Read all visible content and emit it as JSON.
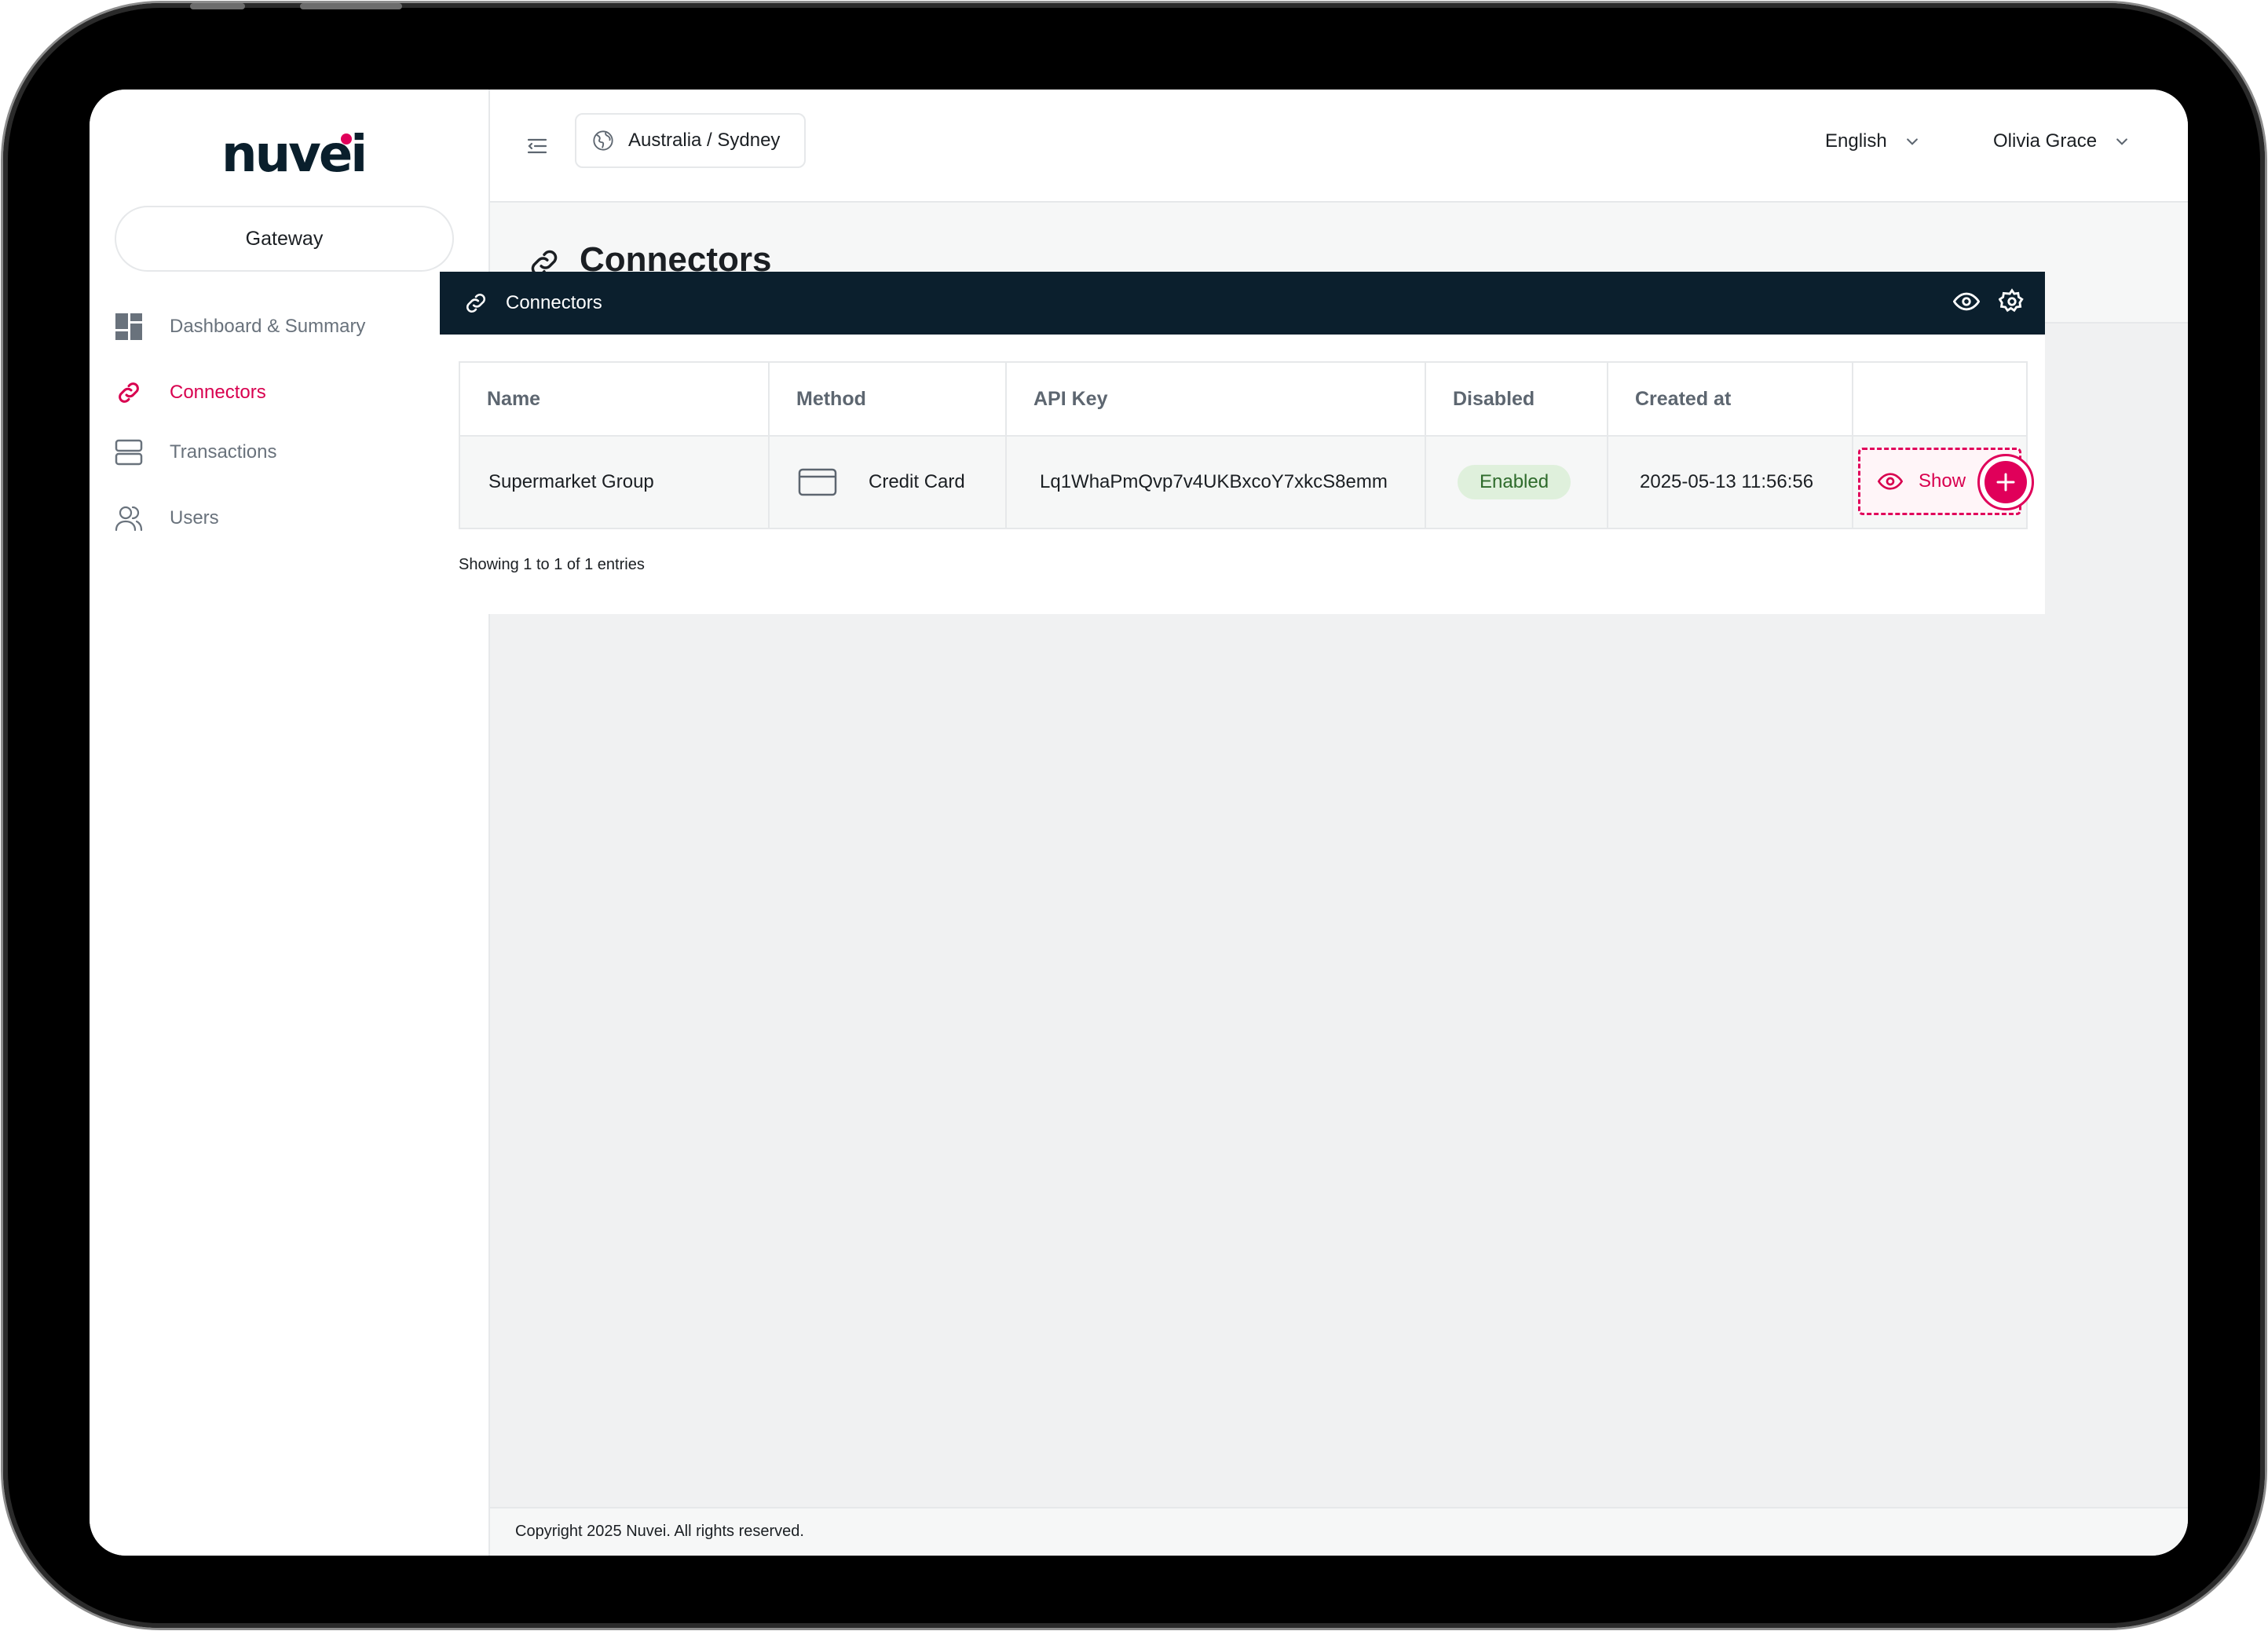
{
  "brand": {
    "logo_text": "nuvei",
    "accent_color": "#e0005a",
    "dark_color": "#0b1f2d"
  },
  "sidebar": {
    "gateway_label": "Gateway",
    "items": [
      {
        "label": "Dashboard & Summary",
        "icon": "dashboard-icon",
        "active": false
      },
      {
        "label": "Connectors",
        "icon": "link-icon",
        "active": true
      },
      {
        "label": "Transactions",
        "icon": "server-icon",
        "active": false,
        "has_submenu": true
      },
      {
        "label": "Users",
        "icon": "users-icon",
        "active": false
      }
    ]
  },
  "header": {
    "timezone": "Australia / Sydney",
    "language": "English",
    "user_name": "Olivia Grace"
  },
  "page": {
    "title": "Connectors"
  },
  "card": {
    "title": "Connectors",
    "columns": [
      "Name",
      "Method",
      "API Key",
      "Disabled",
      "Created at",
      ""
    ],
    "rows": [
      {
        "name": "Supermarket Group",
        "method": "Credit Card",
        "api_key": "Lq1WhaPmQvp7v4UKBxcoY7xkcS8emm",
        "status": "Enabled",
        "created_at": "2025-05-13 11:56:56",
        "action_label": "Show"
      }
    ],
    "entries_info": "Showing 1 to 1 of 1 entries"
  },
  "footer": {
    "copyright": "Copyright 2025 Nuvei. All rights reserved."
  }
}
